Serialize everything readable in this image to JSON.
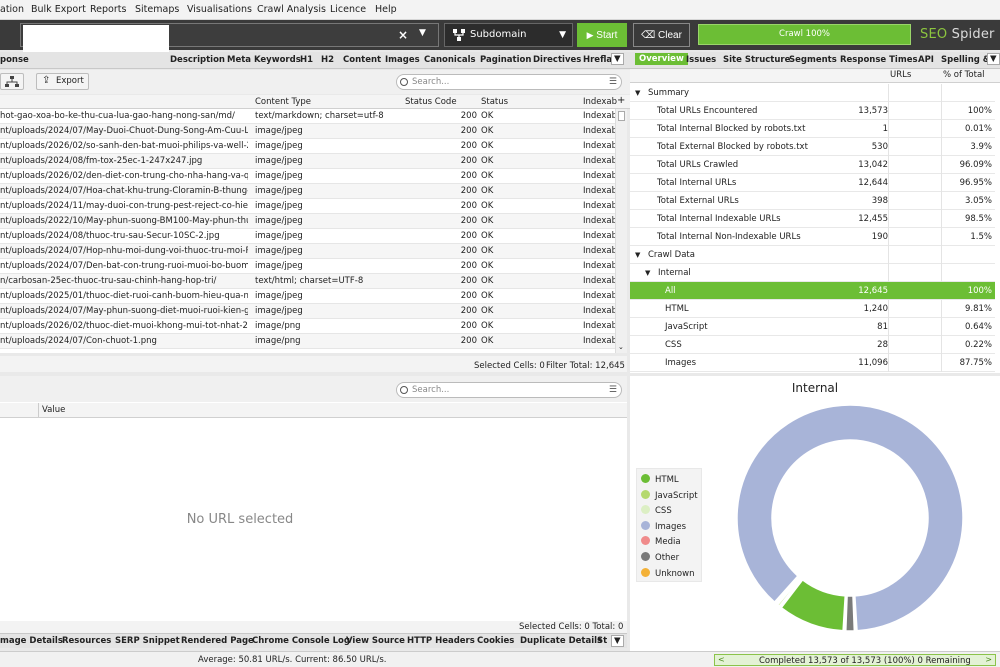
{
  "menu": [
    "ation",
    "Bulk Export",
    "Reports",
    "Sitemaps",
    "Visualisations",
    "Crawl Analysis",
    "Licence",
    "Help"
  ],
  "toolbar": {
    "mode": "Subdomain",
    "start_label": "Start",
    "clear_label": "Clear",
    "progress_label": "Crawl 100%",
    "progress_value": 1.0,
    "brand_seo": "SEO",
    "brand_spider": "Spider"
  },
  "left_tabs": [
    "ponse",
    "Description",
    "Meta Keywords",
    "H1",
    "H2",
    "Content",
    "Images",
    "Canonicals",
    "Pagination",
    "Directives",
    "Hrefla"
  ],
  "left_toolbar": {
    "export_label": "Export",
    "search_placeholder": "Search..."
  },
  "grid": {
    "columns": [
      "Content Type",
      "Status Code",
      "Status",
      "Indexab"
    ],
    "rows": [
      {
        "url": "hot-gao-xoa-bo-ke-thu-cua-lua-gao-hang-nong-san/md/",
        "type": "text/markdown; charset=utf-8",
        "code": "200",
        "status": "OK",
        "idx": "Indexab"
      },
      {
        "url": "nt/uploads/2024/07/May-Duoi-Chuot-Dung-Song-Am-Cuu-L...",
        "type": "image/jpeg",
        "code": "200",
        "status": "OK",
        "idx": "Indexab"
      },
      {
        "url": "nt/uploads/2026/02/so-sanh-den-bat-muoi-philips-va-well-2....",
        "type": "image/jpeg",
        "code": "200",
        "status": "OK",
        "idx": "Indexab"
      },
      {
        "url": "nt/uploads/2024/08/fm-tox-25ec-1-247x247.jpg",
        "type": "image/jpeg",
        "code": "200",
        "status": "OK",
        "idx": "Indexab"
      },
      {
        "url": "nt/uploads/2026/02/den-diet-con-trung-cho-nha-hang-va-qu...",
        "type": "image/jpeg",
        "code": "200",
        "status": "OK",
        "idx": "Indexab"
      },
      {
        "url": "nt/uploads/2024/07/Hoa-chat-khu-trung-Cloramin-B-thung-2...",
        "type": "image/jpeg",
        "code": "200",
        "status": "OK",
        "idx": "Indexab"
      },
      {
        "url": "nt/uploads/2024/11/may-duoi-con-trung-pest-reject-co-hieu-...",
        "type": "image/jpeg",
        "code": "200",
        "status": "OK",
        "idx": "Indexab"
      },
      {
        "url": "nt/uploads/2022/10/May-phun-suong-BM100-May-phun-thu...",
        "type": "image/jpeg",
        "code": "200",
        "status": "OK",
        "idx": "Indexab"
      },
      {
        "url": "nt/uploads/2024/08/thuoc-tru-sau-Secur-10SC-2.jpg",
        "type": "image/jpeg",
        "code": "200",
        "status": "OK",
        "idx": "Indexab"
      },
      {
        "url": "nt/uploads/2024/07/Hop-nhu-moi-dung-voi-thuoc-tru-moi-P...",
        "type": "image/jpeg",
        "code": "200",
        "status": "OK",
        "idx": "Indexab"
      },
      {
        "url": "nt/uploads/2024/07/Den-bat-con-trung-ruoi-muoi-bo-buom-...",
        "type": "image/jpeg",
        "code": "200",
        "status": "OK",
        "idx": "Indexab"
      },
      {
        "url": "n/carbosan-25ec-thuoc-tru-sau-chinh-hang-hop-tri/",
        "type": "text/html; charset=UTF-8",
        "code": "200",
        "status": "OK",
        "idx": "Indexab"
      },
      {
        "url": "nt/uploads/2025/01/thuoc-diet-ruoi-canh-buom-hieu-qua-nh...",
        "type": "image/jpeg",
        "code": "200",
        "status": "OK",
        "idx": "Indexab"
      },
      {
        "url": "nt/uploads/2024/07/May-phun-suong-diet-muoi-ruoi-kien-gi...",
        "type": "image/jpeg",
        "code": "200",
        "status": "OK",
        "idx": "Indexab"
      },
      {
        "url": "nt/uploads/2026/02/thuoc-diet-muoi-khong-mui-tot-nhat-2.p...",
        "type": "image/png",
        "code": "200",
        "status": "OK",
        "idx": "Indexab"
      },
      {
        "url": "nt/uploads/2024/07/Con-chuot-1.png",
        "type": "image/png",
        "code": "200",
        "status": "OK",
        "idx": "Indexab"
      }
    ]
  },
  "left_totals": {
    "selected": "Selected Cells:  0",
    "filter": "Filter Total:  12,645"
  },
  "lower": {
    "search_placeholder": "Search...",
    "value_header": "Value",
    "empty_text": "No URL selected",
    "totals": "Selected Cells:  0  Total:  0"
  },
  "bottom_tabs": [
    "mage Details",
    "Resources",
    "SERP Snippet",
    "Rendered Page",
    "Chrome Console Log",
    "View Source",
    "HTTP Headers",
    "Cookies",
    "Duplicate Details",
    "St"
  ],
  "status": {
    "rate": "Average: 50.81 URL/s. Current: 86.50 URL/s.",
    "completed": "Completed 13,573 of 13,573 (100%) 0 Remaining"
  },
  "right_tabs": [
    "Overview",
    "Issues",
    "Site Structure",
    "Segments",
    "Response Times",
    "API",
    "Spelling &"
  ],
  "overview": {
    "col_urls": "URLs",
    "col_pct": "% of Total",
    "rows": [
      {
        "label": "Summary",
        "urls": "",
        "pct": "",
        "indent": 0,
        "toggle": "▼"
      },
      {
        "label": "Total URLs Encountered",
        "urls": "13,573",
        "pct": "100%",
        "indent": 2,
        "toggle": ""
      },
      {
        "label": "Total Internal Blocked by robots.txt",
        "urls": "1",
        "pct": "0.01%",
        "indent": 2,
        "toggle": ""
      },
      {
        "label": "Total External Blocked by robots.txt",
        "urls": "530",
        "pct": "3.9%",
        "indent": 2,
        "toggle": ""
      },
      {
        "label": "Total URLs Crawled",
        "urls": "13,042",
        "pct": "96.09%",
        "indent": 2,
        "toggle": ""
      },
      {
        "label": "Total Internal URLs",
        "urls": "12,644",
        "pct": "96.95%",
        "indent": 2,
        "toggle": ""
      },
      {
        "label": "Total External URLs",
        "urls": "398",
        "pct": "3.05%",
        "indent": 2,
        "toggle": ""
      },
      {
        "label": "Total Internal Indexable URLs",
        "urls": "12,455",
        "pct": "98.5%",
        "indent": 2,
        "toggle": ""
      },
      {
        "label": "Total Internal Non-Indexable URLs",
        "urls": "190",
        "pct": "1.5%",
        "indent": 2,
        "toggle": ""
      },
      {
        "label": "Crawl Data",
        "urls": "",
        "pct": "",
        "indent": 0,
        "toggle": "▼"
      },
      {
        "label": "Internal",
        "urls": "",
        "pct": "",
        "indent": 1,
        "toggle": "▼"
      },
      {
        "label": "All",
        "urls": "12,645",
        "pct": "100%",
        "indent": 3,
        "toggle": "",
        "selected": true
      },
      {
        "label": "HTML",
        "urls": "1,240",
        "pct": "9.81%",
        "indent": 3,
        "toggle": ""
      },
      {
        "label": "JavaScript",
        "urls": "81",
        "pct": "0.64%",
        "indent": 3,
        "toggle": ""
      },
      {
        "label": "CSS",
        "urls": "28",
        "pct": "0.22%",
        "indent": 3,
        "toggle": ""
      },
      {
        "label": "Images",
        "urls": "11,096",
        "pct": "87.75%",
        "indent": 3,
        "toggle": ""
      }
    ]
  },
  "chart_data": {
    "type": "pie",
    "title": "Internal",
    "categories": [
      "HTML",
      "JavaScript",
      "CSS",
      "Images",
      "Media",
      "Other",
      "Unknown"
    ],
    "values": [
      1240,
      81,
      28,
      11096,
      0,
      200,
      0
    ],
    "colors": [
      "#6cbe35",
      "#b5d96e",
      "#dcefc4",
      "#a8b4d8",
      "#f08b8b",
      "#7a7a7a",
      "#f3b137"
    ],
    "legend": "left"
  },
  "colors": {
    "accent": "#6cbe35",
    "topbar": "#3a3a3a"
  }
}
